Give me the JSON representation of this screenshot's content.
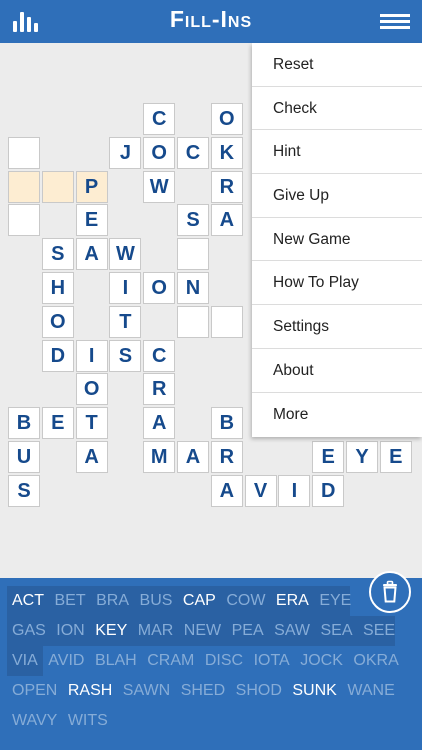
{
  "header": {
    "title": "Fill-Ins",
    "background": "#2f6fb9"
  },
  "board": {
    "cells": [
      {
        "r": 0,
        "c": 4,
        "l": "C"
      },
      {
        "r": 0,
        "c": 6,
        "l": "O"
      },
      {
        "r": 1,
        "c": 0,
        "l": ""
      },
      {
        "r": 1,
        "c": 3,
        "l": "J"
      },
      {
        "r": 1,
        "c": 4,
        "l": "O"
      },
      {
        "r": 1,
        "c": 5,
        "l": "C"
      },
      {
        "r": 1,
        "c": 6,
        "l": "K"
      },
      {
        "r": 2,
        "c": 0,
        "l": "",
        "hl": true
      },
      {
        "r": 2,
        "c": 1,
        "l": "",
        "hl": true
      },
      {
        "r": 2,
        "c": 2,
        "l": "P",
        "hl": true
      },
      {
        "r": 2,
        "c": 4,
        "l": "W"
      },
      {
        "r": 2,
        "c": 6,
        "l": "R"
      },
      {
        "r": 3,
        "c": 0,
        "l": ""
      },
      {
        "r": 3,
        "c": 2,
        "l": "E"
      },
      {
        "r": 3,
        "c": 5,
        "l": "S"
      },
      {
        "r": 3,
        "c": 6,
        "l": "A"
      },
      {
        "r": 4,
        "c": 1,
        "l": "S"
      },
      {
        "r": 4,
        "c": 2,
        "l": "A"
      },
      {
        "r": 4,
        "c": 3,
        "l": "W"
      },
      {
        "r": 4,
        "c": 5,
        "l": ""
      },
      {
        "r": 5,
        "c": 1,
        "l": "H"
      },
      {
        "r": 5,
        "c": 3,
        "l": "I"
      },
      {
        "r": 5,
        "c": 4,
        "l": "O"
      },
      {
        "r": 5,
        "c": 5,
        "l": "N"
      },
      {
        "r": 6,
        "c": 1,
        "l": "O"
      },
      {
        "r": 6,
        "c": 3,
        "l": "T"
      },
      {
        "r": 6,
        "c": 5,
        "l": ""
      },
      {
        "r": 6,
        "c": 6,
        "l": ""
      },
      {
        "r": 7,
        "c": 1,
        "l": "D"
      },
      {
        "r": 7,
        "c": 2,
        "l": "I"
      },
      {
        "r": 7,
        "c": 3,
        "l": "S"
      },
      {
        "r": 7,
        "c": 4,
        "l": "C"
      },
      {
        "r": 8,
        "c": 2,
        "l": "O"
      },
      {
        "r": 8,
        "c": 4,
        "l": "R"
      },
      {
        "r": 9,
        "c": 0,
        "l": "B"
      },
      {
        "r": 9,
        "c": 1,
        "l": "E"
      },
      {
        "r": 9,
        "c": 2,
        "l": "T"
      },
      {
        "r": 9,
        "c": 4,
        "l": "A"
      },
      {
        "r": 9,
        "c": 6,
        "l": "B"
      },
      {
        "r": 10,
        "c": 0,
        "l": "U"
      },
      {
        "r": 10,
        "c": 2,
        "l": "A"
      },
      {
        "r": 10,
        "c": 4,
        "l": "M"
      },
      {
        "r": 10,
        "c": 5,
        "l": "A"
      },
      {
        "r": 10,
        "c": 6,
        "l": "R"
      },
      {
        "r": 10,
        "c": 9,
        "l": "E"
      },
      {
        "r": 10,
        "c": 10,
        "l": "Y"
      },
      {
        "r": 10,
        "c": 11,
        "l": "E"
      },
      {
        "r": 11,
        "c": 0,
        "l": "S"
      },
      {
        "r": 11,
        "c": 6,
        "l": "A"
      },
      {
        "r": 11,
        "c": 7,
        "l": "V"
      },
      {
        "r": 11,
        "c": 8,
        "l": "I"
      },
      {
        "r": 11,
        "c": 9,
        "l": "D"
      }
    ],
    "highlight_color": "#fdedd2",
    "letter_color": "#164a8c"
  },
  "menu": {
    "items": [
      "Reset",
      "Check",
      "Hint",
      "Give Up",
      "New Game",
      "How To Play",
      "Settings",
      "About",
      "More"
    ]
  },
  "word_bank": {
    "rows": [
      [
        {
          "t": "ACT",
          "on": true
        },
        {
          "t": "BET"
        },
        {
          "t": "BRA"
        },
        {
          "t": "BUS"
        },
        {
          "t": "CAP",
          "on": true
        },
        {
          "t": "COW"
        },
        {
          "t": "ERA",
          "on": true
        },
        {
          "t": "EYE"
        }
      ],
      [
        {
          "t": "GAS"
        },
        {
          "t": "ION"
        },
        {
          "t": "KEY",
          "on": true
        },
        {
          "t": "MAR"
        },
        {
          "t": "NEW"
        },
        {
          "t": "PEA"
        },
        {
          "t": "SAW"
        },
        {
          "t": "SEA"
        },
        {
          "t": "SEE"
        }
      ],
      [
        {
          "t": "VIA"
        },
        {
          "t": "AVID"
        },
        {
          "t": "BLAH"
        },
        {
          "t": "CRAM"
        },
        {
          "t": "DISC"
        },
        {
          "t": "IOTA"
        },
        {
          "t": "JOCK"
        },
        {
          "t": "OKRA"
        }
      ],
      [
        {
          "t": "OPEN"
        },
        {
          "t": "RASH",
          "on": true
        },
        {
          "t": "SAWN"
        },
        {
          "t": "SHED"
        },
        {
          "t": "SHOD"
        },
        {
          "t": "SUNK",
          "on": true
        },
        {
          "t": "WANE"
        }
      ],
      [
        {
          "t": "WAVY"
        },
        {
          "t": "WITS"
        }
      ]
    ],
    "active_color": "#ffffff",
    "used_color": "#86acd7"
  },
  "icons": {
    "stats": "bar-chart-icon",
    "menu": "hamburger-menu-icon",
    "trash": "trash-icon"
  }
}
